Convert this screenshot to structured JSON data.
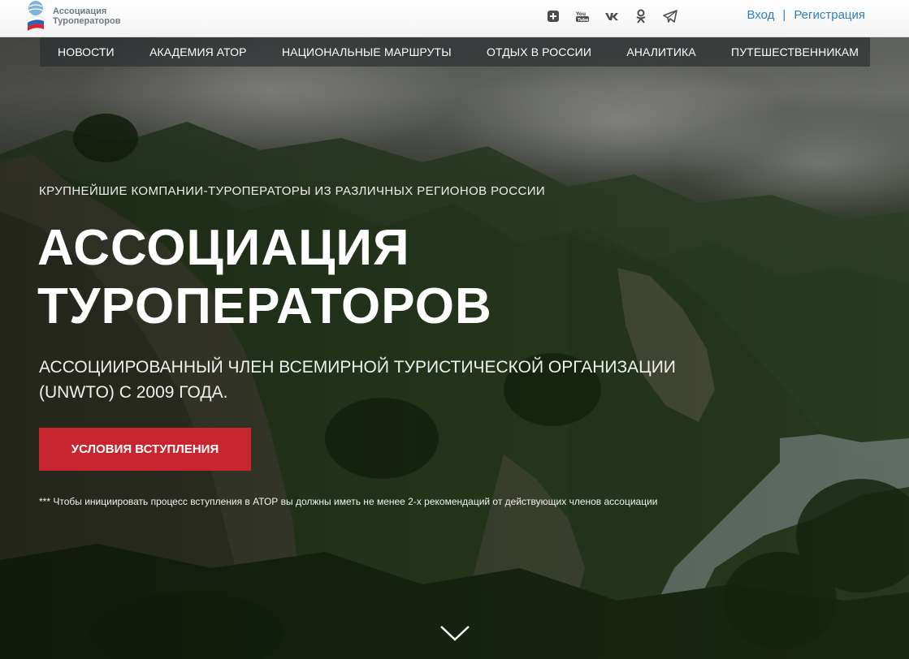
{
  "logo": {
    "line1": "Ассоциация",
    "line2": "Туроператоров"
  },
  "social": [
    {
      "name": "plus-icon",
      "glyph": "+"
    },
    {
      "name": "youtube-icon",
      "glyph": "You"
    },
    {
      "name": "vk-icon",
      "glyph": "VK"
    },
    {
      "name": "odnoklassniki-icon",
      "glyph": "OK"
    },
    {
      "name": "telegram-icon",
      "glyph": "➤"
    }
  ],
  "auth": {
    "login": "Вход",
    "separator": "|",
    "register": "Регистрация"
  },
  "nav": {
    "items": [
      "НОВОСТИ",
      "АКАДЕМИЯ АТОР",
      "НАЦИОНАЛЬНЫЕ МАРШРУТЫ",
      "ОТДЫХ В РОССИИ",
      "АНАЛИТИКА",
      "ПУТЕШЕСТВЕННИКАМ"
    ]
  },
  "hero": {
    "eyebrow": "КРУПНЕЙШИЕ КОМПАНИИ-ТУРОПЕРАТОРЫ ИЗ РАЗЛИЧНЫХ РЕГИОНОВ РОССИИ",
    "title_line1": "АССОЦИАЦИЯ",
    "title_line2": "ТУРОПЕРАТОРОВ",
    "subtitle": "АССОЦИИРОВАННЫЙ ЧЛЕН ВСЕМИРНОЙ ТУРИСТИЧЕСКОЙ ОРГАНИЗАЦИИ (UNWTO) С 2009 ГОДА.",
    "cta_label": "УСЛОВИЯ ВСТУПЛЕНИЯ",
    "note": "*** Чтобы инициировать процесс вступления в АТОР вы должны иметь не менее 2-х рекомендаций от действующих членов ассоциации"
  },
  "colors": {
    "accent": "#c9252f",
    "link": "#2f7fc1",
    "nav_bg": "#2d3032"
  },
  "icons": {
    "scroll": "chevron-down-icon",
    "logo": "globe-logo-icon"
  }
}
